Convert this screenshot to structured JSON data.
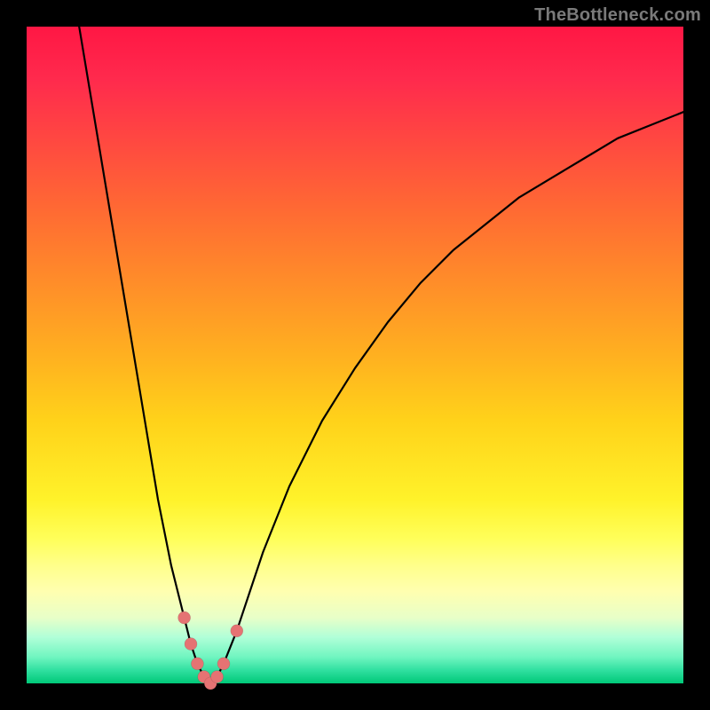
{
  "watermark": "TheBottleneck.com",
  "colors": {
    "background": "#000000",
    "curve": "#000000",
    "dots": "#e57373",
    "gradient_top": "#ff1744",
    "gradient_bottom": "#00c878"
  },
  "chart_data": {
    "type": "line",
    "title": "",
    "xlabel": "",
    "ylabel": "",
    "xlim": [
      0,
      100
    ],
    "ylim": [
      0,
      100
    ],
    "note": "Plot area uses a red→yellow→green vertical gradient. y is drawn inverted (0 at top).",
    "series": [
      {
        "name": "curve",
        "x": [
          8,
          10,
          12,
          14,
          16,
          18,
          20,
          22,
          24,
          25,
          26,
          27,
          28,
          29,
          30,
          32,
          34,
          36,
          40,
          45,
          50,
          55,
          60,
          65,
          70,
          75,
          80,
          85,
          90,
          95,
          100
        ],
        "y": [
          0,
          12,
          24,
          36,
          48,
          60,
          72,
          82,
          90,
          94,
          97,
          99,
          100,
          99,
          97,
          92,
          86,
          80,
          70,
          60,
          52,
          45,
          39,
          34,
          30,
          26,
          23,
          20,
          17,
          15,
          13
        ]
      }
    ],
    "markers": [
      {
        "x": 24,
        "y": 90
      },
      {
        "x": 25,
        "y": 94
      },
      {
        "x": 26,
        "y": 97
      },
      {
        "x": 27,
        "y": 99
      },
      {
        "x": 28,
        "y": 100
      },
      {
        "x": 29,
        "y": 99
      },
      {
        "x": 30,
        "y": 97
      },
      {
        "x": 32,
        "y": 92
      }
    ]
  }
}
